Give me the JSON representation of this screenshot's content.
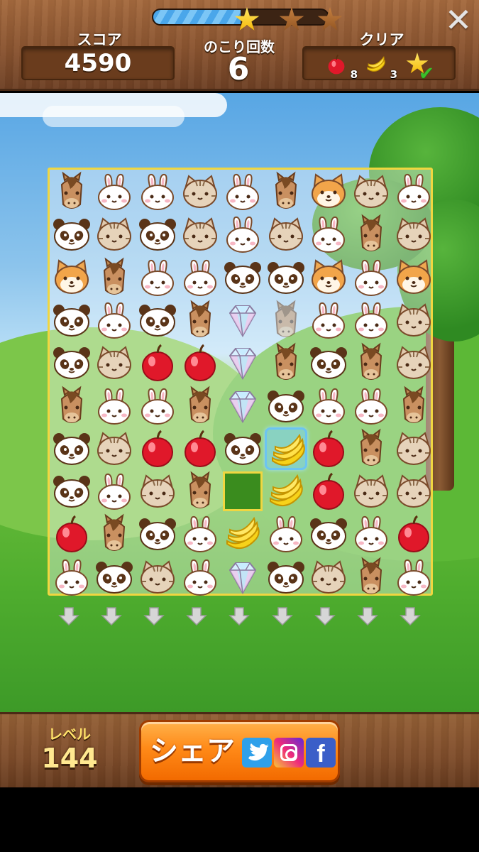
{
  "hud": {
    "score_label": "スコア",
    "score_value": "4590",
    "moves_label": "のこり回数",
    "moves_value": "6",
    "goals_label": "クリア",
    "progress": 0.5,
    "stars_earned": 1,
    "stars_total": 3,
    "close_icon": "close-icon",
    "goals": [
      {
        "item": "apple",
        "count": "8"
      },
      {
        "item": "banana",
        "count": "3"
      },
      {
        "item": "star",
        "status": "complete"
      }
    ]
  },
  "board": {
    "cols": 9,
    "rows": 10,
    "grid": [
      [
        "horse",
        "rabbit",
        "rabbit",
        "cat",
        "rabbit",
        "horse",
        "shiba",
        "cat",
        "rabbit"
      ],
      [
        "panda",
        "cat",
        "panda",
        "cat",
        "rabbit",
        "cat",
        "rabbit",
        "horse",
        "cat"
      ],
      [
        "shiba",
        "horse",
        "rabbit",
        "rabbit",
        "panda",
        "panda",
        "shiba",
        "rabbit",
        "shiba"
      ],
      [
        "panda",
        "rabbit",
        "panda",
        "horse",
        "diamond",
        "horse",
        "rabbit",
        "rabbit",
        "cat"
      ],
      [
        "panda",
        "cat",
        "apple",
        "apple",
        "diamond",
        "horse",
        "panda",
        "horse",
        "cat"
      ],
      [
        "horse",
        "rabbit",
        "rabbit",
        "horse",
        "diamond",
        "panda",
        "rabbit",
        "rabbit",
        "horse"
      ],
      [
        "panda",
        "cat",
        "apple",
        "apple",
        "panda",
        "banana",
        "apple",
        "horse",
        "cat"
      ],
      [
        "panda",
        "rabbit",
        "cat",
        "horse",
        "empty",
        "banana",
        "apple",
        "cat",
        "cat"
      ],
      [
        "apple",
        "horse",
        "panda",
        "rabbit",
        "banana",
        "rabbit",
        "panda",
        "rabbit",
        "apple"
      ],
      [
        "rabbit",
        "panda",
        "cat",
        "rabbit",
        "diamond",
        "panda",
        "cat",
        "horse",
        "rabbit"
      ]
    ],
    "selected": {
      "row": 6,
      "col": 5
    },
    "faded": {
      "row": 3,
      "col": 5
    }
  },
  "footer": {
    "level_label": "レベル",
    "level_value": "144",
    "share_label": "シェア",
    "twitter_icon": "twitter-icon",
    "instagram_icon": "instagram-icon",
    "facebook_icon": "facebook-icon",
    "facebook_glyph": "f"
  }
}
